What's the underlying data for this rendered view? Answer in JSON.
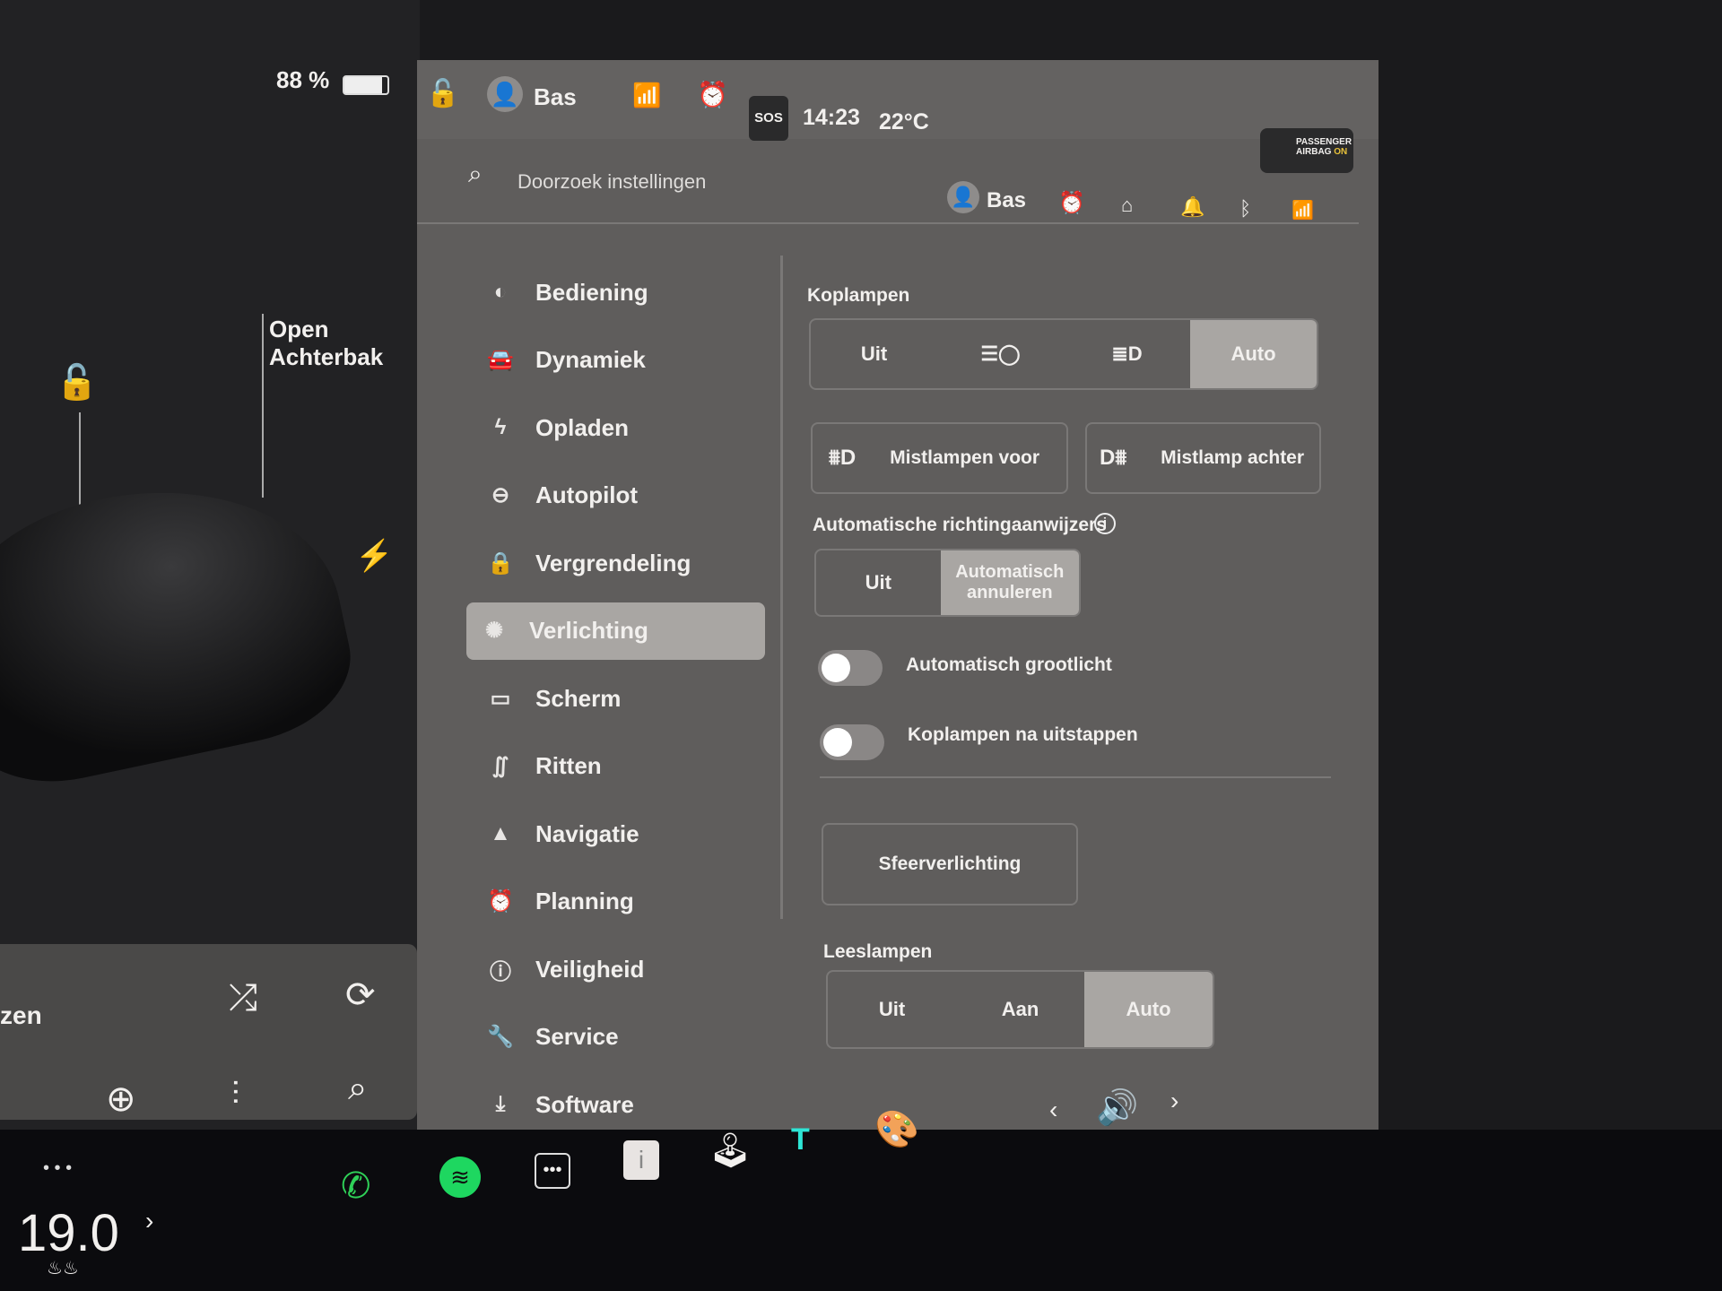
{
  "left_panel": {
    "battery": "88 %",
    "trunk_label_1": "Open",
    "trunk_label_2": "Achterbak",
    "media_partial": "zen"
  },
  "status_bar": {
    "user": "Bas",
    "time": "14:23",
    "temperature": "22°C",
    "sos": "SOS",
    "airbag_1": "PASSENGER",
    "airbag_2": "AIRBAG",
    "airbag_3": "ON"
  },
  "header": {
    "search_placeholder": "Doorzoek instellingen",
    "user": "Bas"
  },
  "menu": [
    {
      "label": "Bediening",
      "icon": "toggle-icon"
    },
    {
      "label": "Dynamiek",
      "icon": "car-icon"
    },
    {
      "label": "Opladen",
      "icon": "bolt-icon"
    },
    {
      "label": "Autopilot",
      "icon": "steering-wheel-icon"
    },
    {
      "label": "Vergrendeling",
      "icon": "lock-icon"
    },
    {
      "label": "Verlichting",
      "icon": "sun-icon",
      "active": true
    },
    {
      "label": "Scherm",
      "icon": "display-icon"
    },
    {
      "label": "Ritten",
      "icon": "trips-icon"
    },
    {
      "label": "Navigatie",
      "icon": "navigation-icon"
    },
    {
      "label": "Planning",
      "icon": "alarm-icon"
    },
    {
      "label": "Veiligheid",
      "icon": "alert-icon"
    },
    {
      "label": "Service",
      "icon": "wrench-icon"
    },
    {
      "label": "Software",
      "icon": "download-icon"
    }
  ],
  "content": {
    "headlights_title": "Koplampen",
    "headlights_options": [
      "Uit",
      "parking-lights-icon",
      "low-beam-icon",
      "Auto"
    ],
    "headlights_selected": "Auto",
    "fog_front": "Mistlampen voor",
    "fog_rear": "Mistlamp achter",
    "turn_signal_title": "Automatische richtingaanwijzers",
    "turn_signal_options": [
      "Uit",
      "Automatisch annuleren"
    ],
    "turn_signal_selected": "Automatisch annuleren",
    "auto_high_beam": {
      "label": "Automatisch grootlicht",
      "on": false
    },
    "headlights_after_exit": {
      "label": "Koplampen na uitstappen",
      "on": false
    },
    "ambient_button": "Sfeerverlichting",
    "reading_title": "Leeslampen",
    "reading_options": [
      "Uit",
      "Aan",
      "Auto"
    ],
    "reading_selected": "Auto"
  },
  "bottom": {
    "cabin_temp": "19.0"
  },
  "colors": {
    "accent_yellow": "#e8c23a",
    "spotify_green": "#1ed760",
    "phone_green": "#2fd158"
  }
}
